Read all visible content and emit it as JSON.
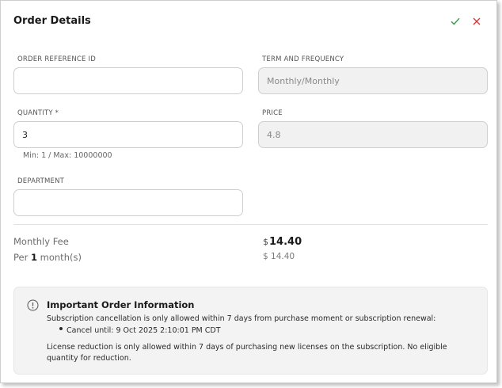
{
  "header": {
    "title": "Order Details"
  },
  "form": {
    "order_ref": {
      "label": "ORDER REFERENCE ID",
      "value": ""
    },
    "term": {
      "label": "TERM AND FREQUENCY",
      "value": "Monthly/Monthly"
    },
    "quantity": {
      "label": "QUANTITY *",
      "value": "3",
      "hint": "Min: 1 / Max: 10000000"
    },
    "price": {
      "label": "PRICE",
      "value": "4.8"
    },
    "department": {
      "label": "DEPARTMENT",
      "value": ""
    }
  },
  "summary": {
    "fee_label": "Monthly Fee",
    "per_prefix": "Per",
    "per_count": "1",
    "per_suffix": "month(s)",
    "currency": "$",
    "total": "14.40",
    "per_amount": "$ 14.40"
  },
  "info": {
    "title": "Important Order Information",
    "line1": "Subscription cancellation is only allowed within 7 days from purchase moment or subscription renewal:",
    "bullet": "Cancel until: 9 Oct 2025 2:10:01 PM CDT",
    "line2a": "License reduction is only allowed within 7 days of purchasing new licenses on the subscription. No eligible",
    "line2b": "quantity for reduction."
  },
  "colors": {
    "confirm": "#2e9e46",
    "cancel": "#d93636",
    "readonly_bg": "#f1f1f1"
  }
}
